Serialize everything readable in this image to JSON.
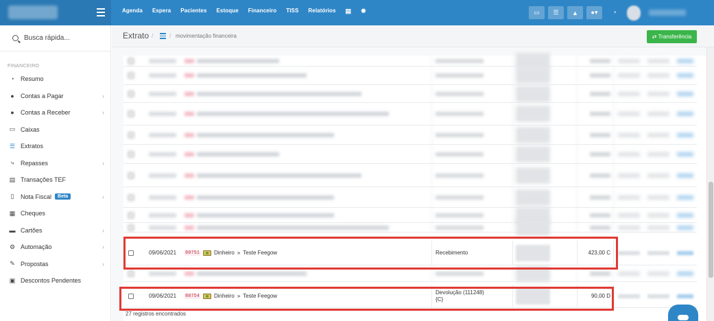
{
  "topbar": {
    "nav": [
      "Agenda",
      "Espera",
      "Pacientes",
      "Estoque",
      "Financeiro",
      "TISS",
      "Relatórios"
    ],
    "nav_icons": [
      "database-icon",
      "gear-icon"
    ],
    "toolbar_icons": [
      "inbox-icon",
      "list-icon",
      "bell-icon",
      "chat-icon",
      "dropdown-icon"
    ]
  },
  "sidebar": {
    "search_label": "Busca rápida...",
    "section": "FINANCEIRO",
    "items": [
      {
        "label": "Resumo",
        "icon": "pie-chart-icon",
        "glyph": "◔",
        "chevron": false
      },
      {
        "label": "Contas a Pagar",
        "icon": "circle-icon",
        "glyph": "●",
        "chevron": true
      },
      {
        "label": "Contas a Receber",
        "icon": "circle-icon",
        "glyph": "●",
        "chevron": true
      },
      {
        "label": "Caixas",
        "icon": "cash-register-icon",
        "glyph": "▭",
        "chevron": false
      },
      {
        "label": "Extratos",
        "icon": "list-icon",
        "glyph": "☰",
        "chevron": false
      },
      {
        "label": "Repasses",
        "icon": "share-icon",
        "glyph": "⤷",
        "chevron": true
      },
      {
        "label": "Transações TEF",
        "icon": "credit-card-icon",
        "glyph": "▤",
        "chevron": false
      },
      {
        "label": "Nota Fiscal",
        "icon": "document-icon",
        "glyph": "▯",
        "chevron": true,
        "badge": "Beta"
      },
      {
        "label": "Cheques",
        "icon": "cheque-icon",
        "glyph": "▦",
        "chevron": false
      },
      {
        "label": "Cartões",
        "icon": "card-icon",
        "glyph": "▬",
        "chevron": true
      },
      {
        "label": "Automação",
        "icon": "cogs-icon",
        "glyph": "⚙",
        "chevron": true
      },
      {
        "label": "Propostas",
        "icon": "proposal-icon",
        "glyph": "✎",
        "chevron": true
      },
      {
        "label": "Descontos Pendentes",
        "icon": "discount-icon",
        "glyph": "▣",
        "chevron": false
      }
    ]
  },
  "header": {
    "title": "Extrato",
    "breadcrumb": "movimentação financeira",
    "transfer_button": "⇄ Transferência"
  },
  "table": {
    "rows": [
      {
        "date": "09/06/2021",
        "code": "80751",
        "account": "Dinheiro",
        "sep": "»",
        "payee": "Teste Feegow",
        "type": "Recebimento",
        "type2": "",
        "value": "423,00 C"
      },
      {
        "date": "09/06/2021",
        "code": "80754",
        "account": "Dinheiro",
        "sep": "»",
        "payee": "Teste Feegow",
        "type": "Devolução (111248)",
        "type2": "{C}",
        "value": "90,00 D"
      }
    ]
  },
  "footer": "27 registros encontrados"
}
